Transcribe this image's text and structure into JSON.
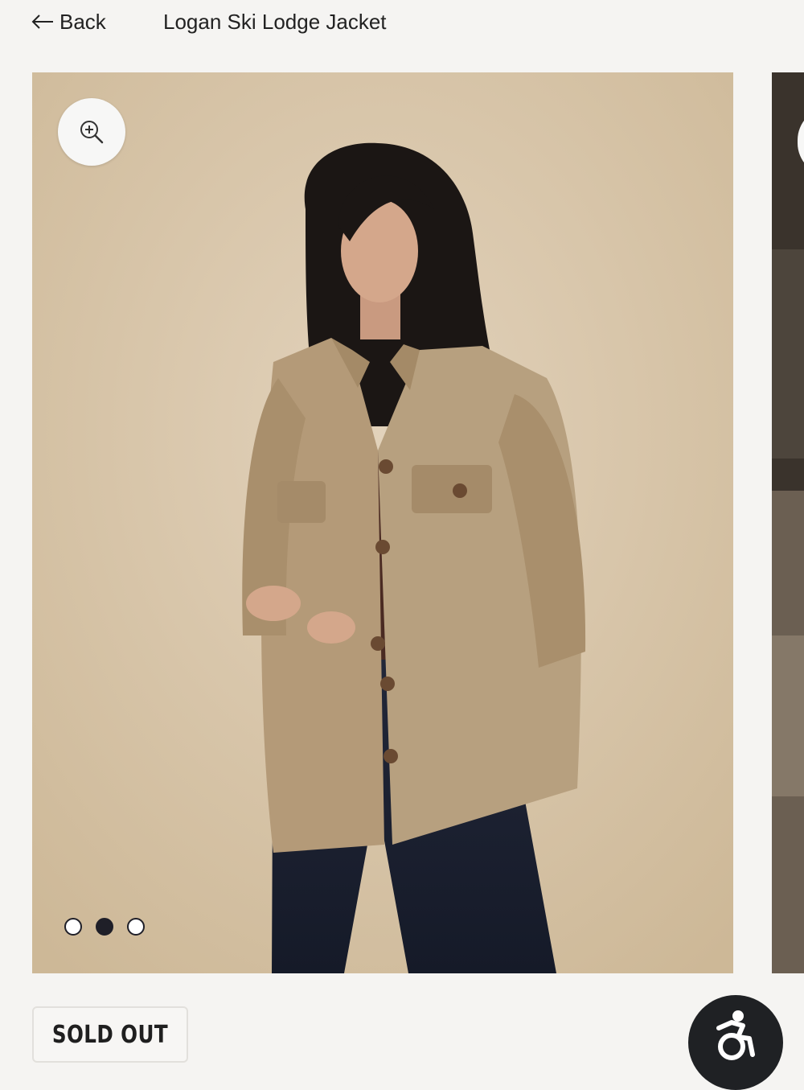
{
  "header": {
    "back_label": "Back",
    "title": "Logan Ski Lodge Jacket"
  },
  "gallery": {
    "slide_count": 3,
    "active_slide": 2,
    "zoom_icon": "zoom-in-icon",
    "photo_subject": "model-wearing-jacket"
  },
  "footer": {
    "sold_out_label": "SOLD OUT",
    "accessibility_icon": "accessibility-wheelchair-icon"
  },
  "colors": {
    "background": "#f5f4f2",
    "photo_backdrop": "#d8c6ab",
    "jacket": "#b49a78",
    "dot_active": "#1f1f28",
    "a11y_button": "#1f2124"
  }
}
